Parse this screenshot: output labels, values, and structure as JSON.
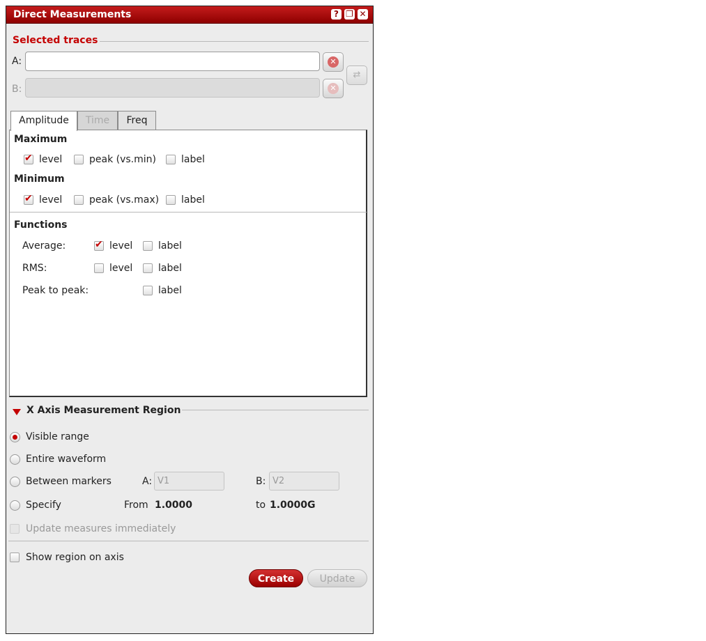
{
  "window": {
    "title": "Direct Measurements",
    "buttons": [
      "?",
      "❐",
      "✕"
    ]
  },
  "selected_traces": {
    "heading": "Selected traces",
    "a_label": "A:",
    "a_value": "",
    "b_label": "B:",
    "b_value": ""
  },
  "tabs": [
    {
      "label": "Amplitude",
      "state": "active"
    },
    {
      "label": "Time",
      "state": "disabled"
    },
    {
      "label": "Freq",
      "state": "enabled"
    }
  ],
  "amplitude": {
    "maximum": {
      "heading": "Maximum",
      "level": "level",
      "peak": "peak (vs.min)",
      "label": "label"
    },
    "minimum": {
      "heading": "Minimum",
      "level": "level",
      "peak": "peak (vs.max)",
      "label": "label"
    },
    "functions": {
      "heading": "Functions",
      "average": {
        "name": "Average:",
        "level": "level",
        "label": "label"
      },
      "rms": {
        "name": "RMS:",
        "level": "level",
        "label": "label"
      },
      "peak_to_peak": {
        "name": "Peak to peak:",
        "label": "label"
      }
    }
  },
  "region": {
    "heading": "X Axis Measurement Region",
    "visible_range": "Visible range",
    "entire_waveform": "Entire waveform",
    "between_markers": "Between markers",
    "marker_a_label": "A:",
    "marker_a_placeholder": "V1",
    "marker_b_label": "B:",
    "marker_b_placeholder": "V2",
    "specify": "Specify",
    "from_label": "From",
    "from_value": "1.0000",
    "to_label": "to",
    "to_value": "1.0000G",
    "update_immediately": "Update measures immediately",
    "show_region": "Show region on axis"
  },
  "buttons": {
    "create": "Create",
    "update": "Update"
  },
  "colors": {
    "accent": "#c40000",
    "titlebar": "#a80c0c"
  }
}
